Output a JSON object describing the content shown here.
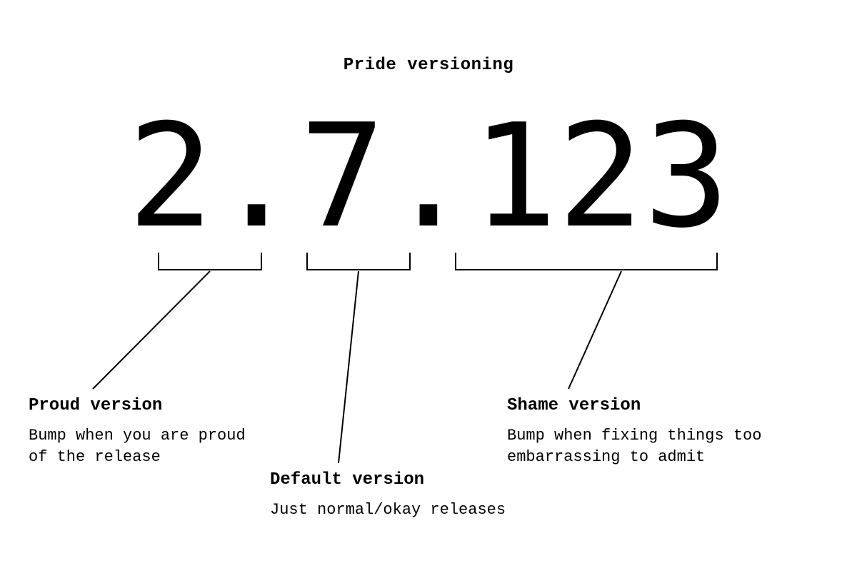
{
  "title": "Pride versioning",
  "version": {
    "proud": "2",
    "default": "7",
    "shame": "123",
    "display": "2.7.123"
  },
  "labels": {
    "proud": {
      "heading": "Proud version",
      "body": "Bump when you are proud of the release"
    },
    "default": {
      "heading": "Default version",
      "body": "Just normal/okay releases"
    },
    "shame": {
      "heading": "Shame version",
      "body": "Bump when fixing things too embarrassing to admit"
    }
  }
}
